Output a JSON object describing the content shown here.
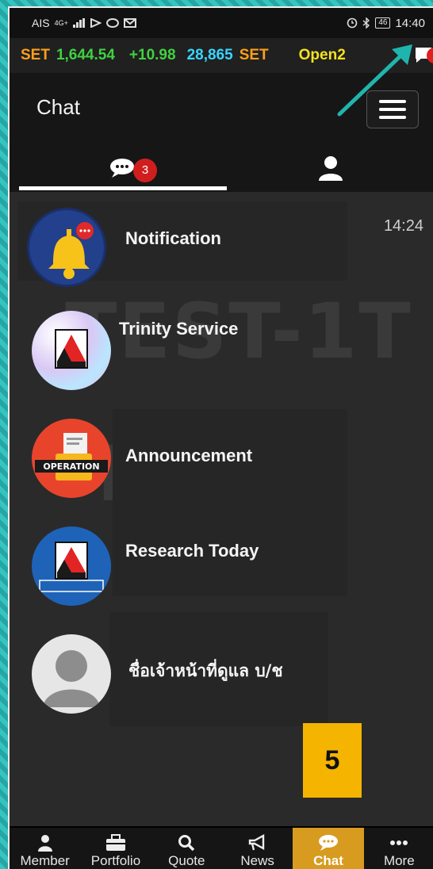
{
  "status_bar": {
    "carrier": "AIS",
    "network": "4G+",
    "battery": "46",
    "time": "14:40"
  },
  "ticker": {
    "label": "SET",
    "index": "1,644.54",
    "change": "+10.98",
    "volume": "28,865",
    "volume_label": "SET",
    "session": "Open2",
    "chat_icon": "chat-bubble-icon"
  },
  "header": {
    "title": "Chat",
    "menu_icon": "hamburger-icon"
  },
  "tabs": [
    {
      "icon": "chat-bubbles-icon",
      "badge": "3",
      "active": true
    },
    {
      "icon": "person-icon",
      "active": false
    }
  ],
  "watermark": {
    "line1": "TEST-1T",
    "line2": "IS"
  },
  "chat_items": [
    {
      "name": "Notification",
      "time": "14:24",
      "avatar": "bell-icon"
    },
    {
      "name": "Trinity Service",
      "time": "",
      "avatar": "trinity-logo"
    },
    {
      "name": "Announcement",
      "time": "",
      "avatar": "operation-icon"
    },
    {
      "name": "Research  Today",
      "time": "",
      "avatar": "trinity-research-logo"
    },
    {
      "name": "ชื่อเจ้าหน้าที่ดูแล บ/ช",
      "time": "",
      "avatar": "default-user-icon"
    }
  ],
  "step_badge": "5",
  "bottom_nav": [
    {
      "label": "Member",
      "icon": "person-icon",
      "active": false
    },
    {
      "label": "Portfolio",
      "icon": "briefcase-icon",
      "active": false
    },
    {
      "label": "Quote",
      "icon": "search-icon",
      "active": false
    },
    {
      "label": "News",
      "icon": "megaphone-icon",
      "active": false
    },
    {
      "label": "Chat",
      "icon": "chat-bubble-icon",
      "active": true
    },
    {
      "label": "More",
      "icon": "dots-icon",
      "active": false
    }
  ],
  "colors": {
    "accent": "#d79b1f",
    "badge": "#d01e1e",
    "step": "#f4b400",
    "annotation": "#1fb5ad"
  }
}
